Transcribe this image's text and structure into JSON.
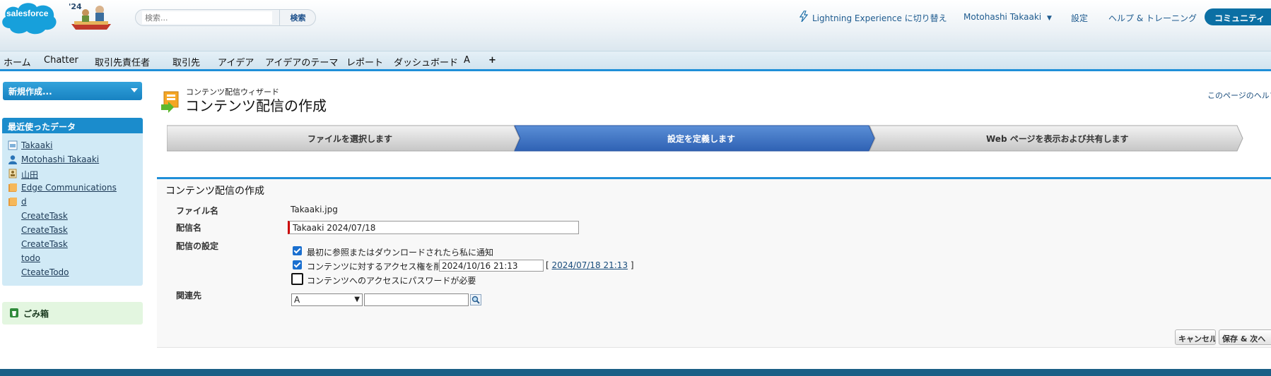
{
  "header": {
    "logo_text": "salesforce",
    "release": "'24",
    "search": {
      "placeholder": "検索...",
      "button": "検索"
    },
    "links": {
      "lightning": "Lightning Experience に切り替え",
      "user": "Motohashi Takaaki",
      "setup": "設定",
      "help": "ヘルプ & トレーニング",
      "community": "コミュニティ"
    }
  },
  "tabs": [
    "ホーム",
    "Chatter",
    "取引先責任者",
    "取引先",
    "アイデア",
    "アイデアのテーマ",
    "レポート",
    "ダッシュボード",
    "A",
    "+"
  ],
  "sidebar": {
    "new_button": "新規作成...",
    "recent_title": "最近使ったデータ",
    "recent_items": [
      "Takaaki",
      "Motohashi Takaaki",
      "山田",
      "Edge Communications",
      "d",
      "CreateTask",
      "CreateTask",
      "CreateTask",
      "todo",
      "CteateTodo"
    ],
    "trash": "ごみ箱"
  },
  "page": {
    "subtitle": "コンテンツ配信ウィザード",
    "title": "コンテンツ配信の作成",
    "help_link": "このページのヘルプ"
  },
  "wizard": {
    "steps": [
      "ファイルを選択します",
      "設定を定義します",
      "Web ページを表示および共有します"
    ],
    "active_step": 2
  },
  "form": {
    "title": "コンテンツ配信の作成",
    "file_label": "ファイル名",
    "file_value": "Takaaki.jpg",
    "name_label": "配信名",
    "name_value": "Takaaki 2024/07/18",
    "settings_label": "配信の設定",
    "notify_label": "最初に参照またはダウンロードされたら私に通知",
    "notify_checked": true,
    "expire_label": "コンテンツに対するアクセス権を削除",
    "expire_checked": true,
    "expire_value": "2024/10/16 21:13",
    "expire_bracket_open": "[",
    "expire_link": "2024/07/18 21:13",
    "expire_bracket_close": "]",
    "password_label": "コンテンツへのアクセスにパスワードが必要",
    "password_checked": false,
    "related_label": "関連先",
    "related_select": "A",
    "related_input": "",
    "cancel_button": "キャンセル",
    "save_next_button": "保存 & 次へ"
  }
}
